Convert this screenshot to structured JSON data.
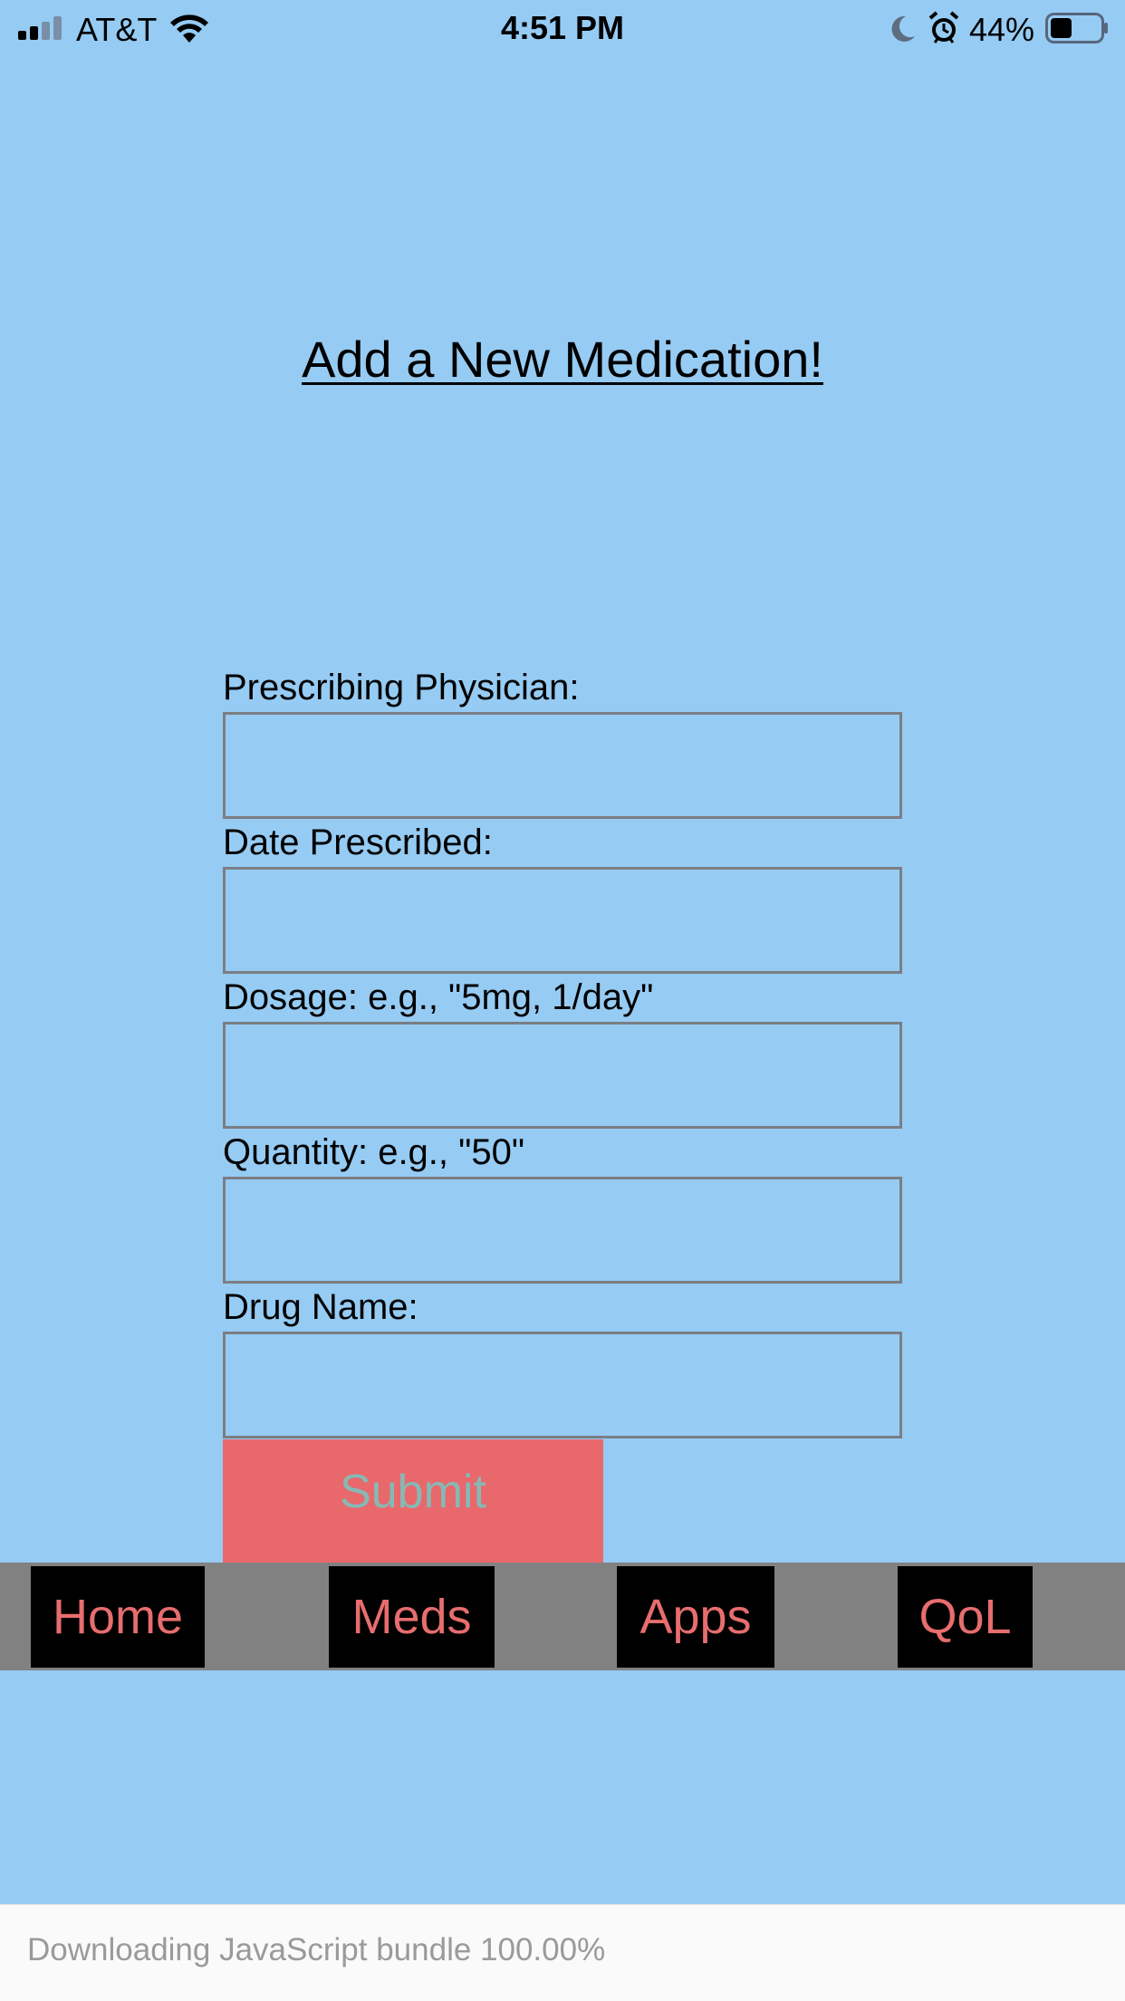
{
  "status_bar": {
    "carrier": "AT&T",
    "time": "4:51 PM",
    "battery_percent": "44%",
    "battery_level": 0.44,
    "signal_bars": 2,
    "icons": [
      "signal-icon",
      "wifi-icon",
      "moon-icon",
      "alarm-icon",
      "battery-icon"
    ]
  },
  "page": {
    "title": "Add a New Medication!"
  },
  "form": {
    "fields": [
      {
        "label": "Prescribing Physician:",
        "value": ""
      },
      {
        "label": "Date Prescribed:",
        "value": ""
      },
      {
        "label": "Dosage: e.g., \"5mg, 1/day\"",
        "value": ""
      },
      {
        "label": "Quantity: e.g., \"50\"",
        "value": ""
      },
      {
        "label": "Drug Name:",
        "value": ""
      }
    ],
    "submit_label": "Submit"
  },
  "nav": {
    "items": [
      {
        "label": "Home"
      },
      {
        "label": "Meds"
      },
      {
        "label": "Apps"
      },
      {
        "label": "QoL"
      }
    ]
  },
  "footer": {
    "text": "Downloading JavaScript bundle 100.00%"
  },
  "colors": {
    "background": "#96cbf3",
    "submit_bg": "#e8686b",
    "submit_text": "#86b9b6",
    "nav_bar": "#818181",
    "nav_button": "#000000",
    "nav_text": "#e76d6e"
  }
}
